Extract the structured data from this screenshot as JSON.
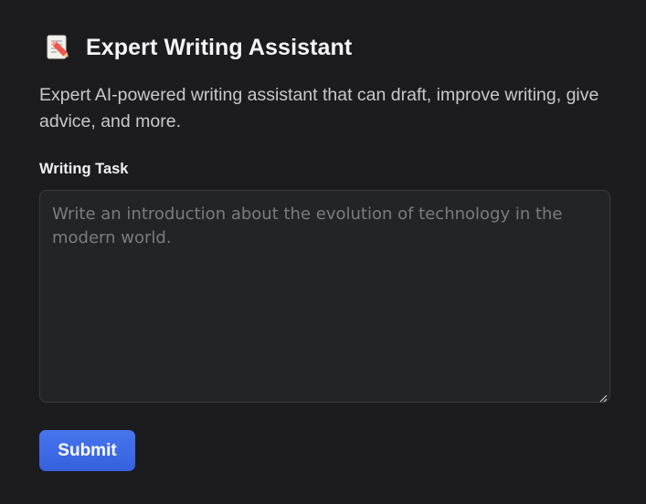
{
  "app": {
    "icon": "memo-pencil-icon",
    "title": "Expert Writing Assistant",
    "description": "Expert AI-powered writing assistant that can draft, improve writing, give advice, and more."
  },
  "form": {
    "task_label": "Writing Task",
    "task_value": "",
    "task_placeholder": "Write an introduction about the evolution of technology in the modern world.",
    "submit_label": "Submit"
  },
  "colors": {
    "background": "#1c1c1f",
    "input_background": "#232428",
    "accent": "#3d6be6"
  }
}
